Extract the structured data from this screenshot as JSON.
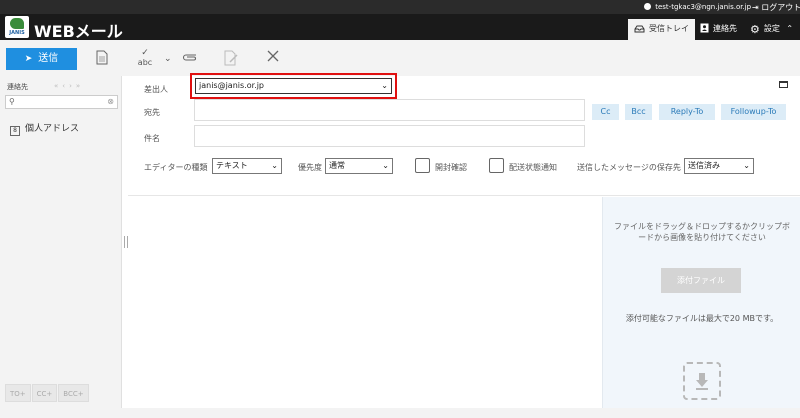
{
  "topbar": {
    "user_email": "test-tgkac3@ngn.janis.or.jp",
    "logout_label": "ログアウト"
  },
  "header": {
    "logo_text": "JANIS",
    "app_title": "WEBメール",
    "nav": {
      "inbox": "受信トレイ",
      "contacts": "連絡先",
      "settings": "設定"
    }
  },
  "toolbar": {
    "send_label": "送信",
    "spell_label": "abc"
  },
  "sidebar": {
    "title": "連絡先",
    "search_placeholder": "",
    "address_book": "個人アドレス",
    "recipient_buttons": [
      "TO+",
      "CC+",
      "BCC+"
    ]
  },
  "compose": {
    "from_label": "差出人",
    "from_value": "janis@janis.or.jp",
    "to_label": "宛先",
    "subject_label": "件名",
    "buttons": {
      "cc": "Cc",
      "bcc": "Bcc",
      "reply_to": "Reply-To",
      "followup_to": "Followup-To"
    },
    "options": {
      "editor_label": "エディターの種類",
      "editor_value": "テキスト",
      "priority_label": "優先度",
      "priority_value": "通常",
      "read_receipt_label": "開封確認",
      "dsn_label": "配送状態通知",
      "save_label": "送信したメッセージの保存先",
      "save_value": "送信済み"
    }
  },
  "attachments": {
    "drop_hint": "ファイルをドラッグ＆ドロップするかクリップボードから画像を貼り付けてください",
    "attach_button": "添付ファイル",
    "max_size_note": "添付可能なファイルは最大で20 MBです。"
  },
  "colors": {
    "accent": "#1f8fe0",
    "highlight": "#e01010",
    "header_bg": "#1a1a1a"
  }
}
